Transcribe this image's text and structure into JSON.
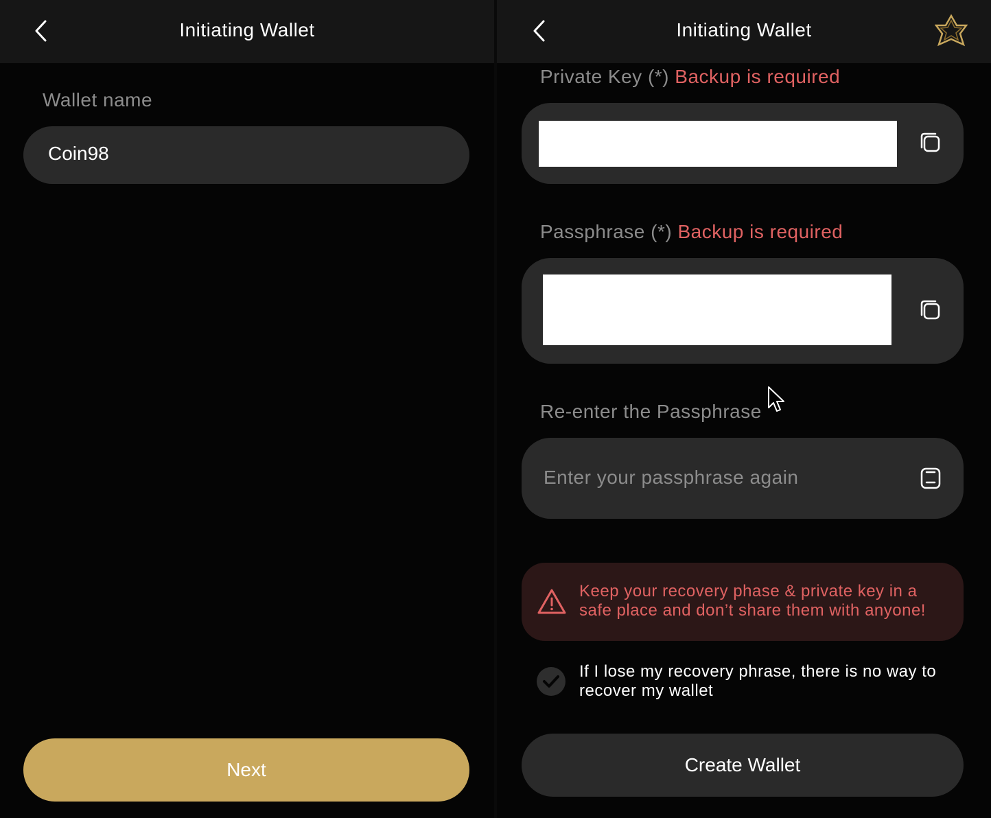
{
  "left": {
    "header": {
      "title": "Initiating Wallet"
    },
    "wallet_name_label": "Wallet name",
    "wallet_name_value": "Coin98",
    "next_label": "Next"
  },
  "right": {
    "header": {
      "title": "Initiating Wallet"
    },
    "private_key": {
      "label": "Private Key (*)",
      "required": "Backup is required"
    },
    "passphrase": {
      "label": "Passphrase (*)",
      "required": "Backup is required"
    },
    "reenter": {
      "label": "Re-enter the Passphrase",
      "placeholder": "Enter your passphrase again"
    },
    "warning": "Keep your recovery phase & private key in a safe place and don’t share them with anyone!",
    "acknowledge": "If I lose my recovery phrase, there is no way to recover my wallet",
    "create_label": "Create Wallet"
  },
  "colors": {
    "accent_gold": "#c9a85d",
    "warning_red": "#e06262",
    "field_bg": "#2a2a2a",
    "header_bg": "#161616"
  },
  "icons": [
    "chevron-left-icon",
    "coin98-logo-icon",
    "copy-icon",
    "paste-icon",
    "warning-triangle-icon",
    "checkmark-icon",
    "mouse-cursor-icon"
  ]
}
